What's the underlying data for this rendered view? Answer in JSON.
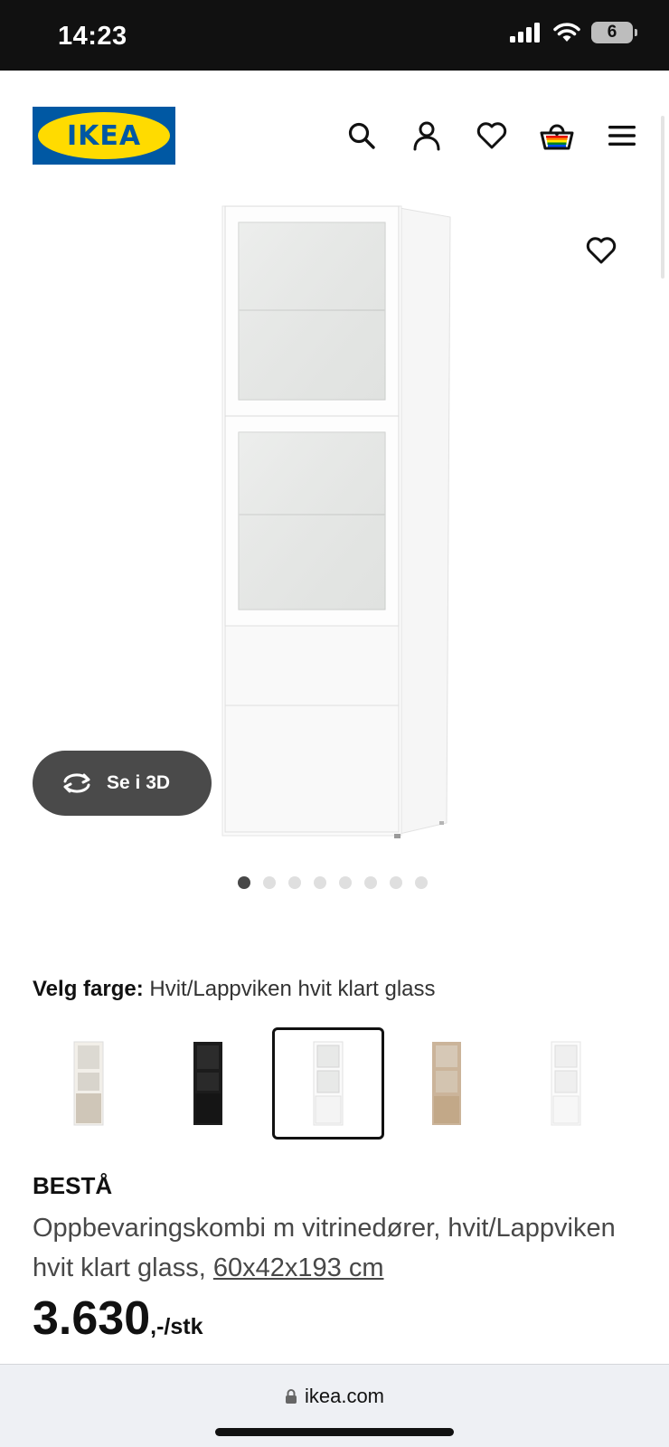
{
  "status_bar": {
    "time": "14:23",
    "battery": "6"
  },
  "header": {
    "logo_text": "IKEA",
    "icons": [
      "search-icon",
      "profile-icon",
      "favorites-icon",
      "cart-icon",
      "menu-icon"
    ]
  },
  "gallery": {
    "view_3d_label": "Se i 3D",
    "dot_count": 8,
    "active_dot": 1
  },
  "color_select": {
    "label": "Velg farge:",
    "value": "Hvit/Lappviken hvit klart glass",
    "swatches": [
      "white-stained-oak",
      "black-brown",
      "white-clear-glass",
      "oak-effect",
      "white-frosted"
    ],
    "selected_index": 2
  },
  "product": {
    "name": "BESTÅ",
    "description": "Oppbevaringskombi m vitrinedører, hvit/Lappviken hvit klart glass,",
    "dimensions": "60x42x193 cm",
    "price": "3.630",
    "price_suffix": ",-/stk"
  },
  "browser": {
    "url": "ikea.com"
  },
  "colors": {
    "brand_blue": "#0058a3",
    "brand_yellow": "#ffdb00",
    "status_bar_bg": "#111111",
    "pill_bg": "#4a4a4a"
  }
}
